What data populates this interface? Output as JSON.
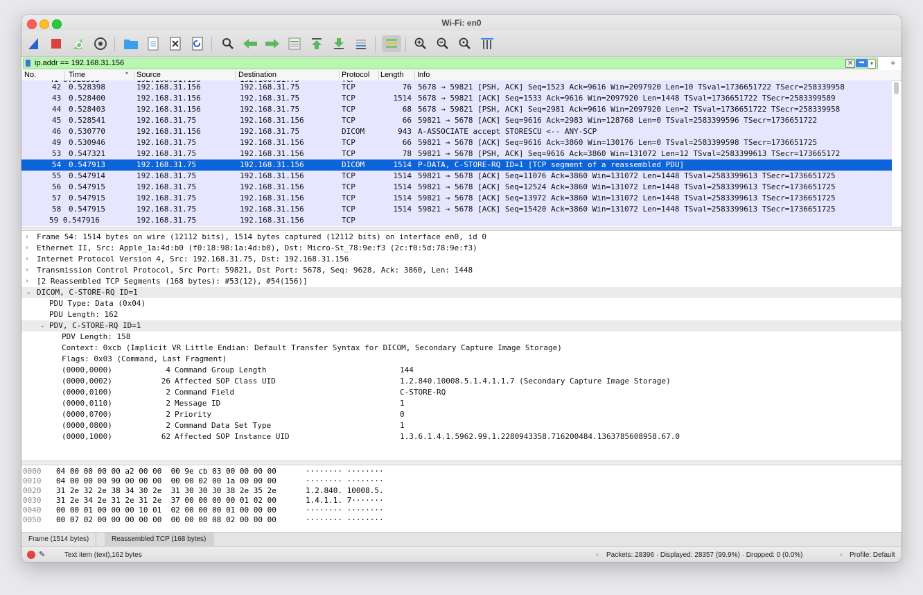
{
  "window": {
    "title": "Wi-Fi: en0"
  },
  "filter": {
    "text": "ip.addr == 192.168.31.156",
    "plus": "+"
  },
  "columns": {
    "no": "No.",
    "time": "Time",
    "source": "Source",
    "destination": "Destination",
    "protocol": "Protocol",
    "length": "Length",
    "info": "Info"
  },
  "packets": [
    {
      "no": "42",
      "time": "0.528398",
      "src": "192.168.31.156",
      "dst": "192.168.31.75",
      "proto": "TCP",
      "len": "76",
      "info": "5678 → 59821 [PSH, ACK] Seq=1523 Ack=9616 Win=2097920 Len=10 TSval=1736651722 TSecr=258339958"
    },
    {
      "no": "43",
      "time": "0.528400",
      "src": "192.168.31.156",
      "dst": "192.168.31.75",
      "proto": "TCP",
      "len": "1514",
      "info": "5678 → 59821 [ACK] Seq=1533 Ack=9616 Win=2097920 Len=1448 TSval=1736651722 TSecr=2583399589"
    },
    {
      "no": "44",
      "time": "0.528403",
      "src": "192.168.31.156",
      "dst": "192.168.31.75",
      "proto": "TCP",
      "len": "68",
      "info": "5678 → 59821 [PSH, ACK] Seq=2981 Ack=9616 Win=2097920 Len=2 TSval=1736651722 TSecr=258339958"
    },
    {
      "no": "45",
      "time": "0.528541",
      "src": "192.168.31.75",
      "dst": "192.168.31.156",
      "proto": "TCP",
      "len": "66",
      "info": "59821 → 5678 [ACK] Seq=9616 Ack=2983 Win=128768 Len=0 TSval=2583399596 TSecr=1736651722"
    },
    {
      "no": "46",
      "time": "0.530770",
      "src": "192.168.31.156",
      "dst": "192.168.31.75",
      "proto": "DICOM",
      "len": "943",
      "info": "A-ASSOCIATE accept  STORESCU <-- ANY-SCP"
    },
    {
      "no": "49",
      "time": "0.530946",
      "src": "192.168.31.75",
      "dst": "192.168.31.156",
      "proto": "TCP",
      "len": "66",
      "info": "59821 → 5678 [ACK] Seq=9616 Ack=3860 Win=130176 Len=0 TSval=2583399598 TSecr=1736651725"
    },
    {
      "no": "53",
      "time": "0.547321",
      "src": "192.168.31.75",
      "dst": "192.168.31.156",
      "proto": "TCP",
      "len": "78",
      "info": "59821 → 5678 [PSH, ACK] Seq=9616 Ack=3860 Win=131072 Len=12 TSval=2583399613 TSecr=173665172"
    },
    {
      "no": "54",
      "time": "0.547913",
      "src": "192.168.31.75",
      "dst": "192.168.31.156",
      "proto": "DICOM",
      "len": "1514",
      "info": "P-DATA, C-STORE-RQ ID=1 [TCP segment of a reassembled PDU]"
    },
    {
      "no": "55",
      "time": "0.547914",
      "src": "192.168.31.75",
      "dst": "192.168.31.156",
      "proto": "TCP",
      "len": "1514",
      "info": "59821 → 5678 [ACK] Seq=11076 Ack=3860 Win=131072 Len=1448 TSval=2583399613 TSecr=1736651725"
    },
    {
      "no": "56",
      "time": "0.547915",
      "src": "192.168.31.75",
      "dst": "192.168.31.156",
      "proto": "TCP",
      "len": "1514",
      "info": "59821 → 5678 [ACK] Seq=12524 Ack=3860 Win=131072 Len=1448 TSval=2583399613 TSecr=1736651725"
    },
    {
      "no": "57",
      "time": "0.547915",
      "src": "192.168.31.75",
      "dst": "192.168.31.156",
      "proto": "TCP",
      "len": "1514",
      "info": "59821 → 5678 [ACK] Seq=13972 Ack=3860 Win=131072 Len=1448 TSval=2583399613 TSecr=1736651725"
    },
    {
      "no": "58",
      "time": "0.547915",
      "src": "192.168.31.75",
      "dst": "192.168.31.156",
      "proto": "TCP",
      "len": "1514",
      "info": "59821 → 5678 [ACK] Seq=15420 Ack=3860 Win=131072 Len=1448 TSval=2583399613 TSecr=1736651725"
    }
  ],
  "selected_packet": "54",
  "details": [
    {
      "text": "Frame 54: 1514 bytes on wire (12112 bits), 1514 bytes captured (12112 bits) on interface en0, id 0"
    },
    {
      "text": "Ethernet II, Src: Apple_1a:4d:b0 (f0:18:98:1a:4d:b0), Dst: Micro-St_78:9e:f3 (2c:f0:5d:78:9e:f3)"
    },
    {
      "text": "Internet Protocol Version 4, Src: 192.168.31.75, Dst: 192.168.31.156"
    },
    {
      "text": "Transmission Control Protocol, Src Port: 59821, Dst Port: 5678, Seq: 9628, Ack: 3860, Len: 1448"
    },
    {
      "text": "[2 Reassembled TCP Segments (168 bytes): #53(12), #54(156)]"
    },
    {
      "text": "DICOM, C-STORE-RQ ID=1"
    },
    {
      "text": "PDU Type: Data (0x04)"
    },
    {
      "text": "PDU Length: 162"
    },
    {
      "text": "PDV, C-STORE-RQ ID=1"
    },
    {
      "text": "PDV Length: 158"
    },
    {
      "text": "Context: 0xcb (Implicit VR Little Endian: Default Transfer Syntax for DICOM, Secondary Capture Image Storage)"
    },
    {
      "text": "Flags: 0x03 (Command, Last Fragment)"
    }
  ],
  "dicom_elements": [
    {
      "tag": "(0000,0000)",
      "len": "4",
      "name": "Command Group Length",
      "value": "144"
    },
    {
      "tag": "(0000,0002)",
      "len": "26",
      "name": "Affected SOP Class UID",
      "value": "1.2.840.10008.5.1.4.1.1.7 (Secondary Capture Image Storage)"
    },
    {
      "tag": "(0000,0100)",
      "len": "2",
      "name": "Command Field",
      "value": "C-STORE-RQ"
    },
    {
      "tag": "(0000,0110)",
      "len": "2",
      "name": "Message ID",
      "value": "1"
    },
    {
      "tag": "(0000,0700)",
      "len": "2",
      "name": "Priority",
      "value": "0"
    },
    {
      "tag": "(0000,0800)",
      "len": "2",
      "name": "Command Data Set Type",
      "value": "1"
    },
    {
      "tag": "(0000,1000)",
      "len": "62",
      "name": "Affected SOP Instance UID",
      "value": "1.3.6.1.4.1.5962.99.1.2280943358.716200484.1363785608958.67.0"
    }
  ],
  "hex": [
    {
      "off": "0000",
      "hex": "04 00 00 00 00 a2 00 00  00 9e cb 03 00 00 00 00",
      "ascii": "········ ········"
    },
    {
      "off": "0010",
      "hex": "04 00 00 00 90 00 00 00  00 00 02 00 1a 00 00 00",
      "ascii": "········ ········"
    },
    {
      "off": "0020",
      "hex": "31 2e 32 2e 38 34 30 2e  31 30 30 30 38 2e 35 2e",
      "ascii": "1.2.840. 10008.5."
    },
    {
      "off": "0030",
      "hex": "31 2e 34 2e 31 2e 31 2e  37 00 00 00 00 01 02 00",
      "ascii": "1.4.1.1. 7·······"
    },
    {
      "off": "0040",
      "hex": "00 00 01 00 00 00 10 01  02 00 00 00 01 00 00 00",
      "ascii": "········ ········"
    },
    {
      "off": "0050",
      "hex": "00 07 02 00 00 00 00 00  00 00 00 08 02 00 00 00",
      "ascii": "········ ········"
    }
  ],
  "byte_tabs": [
    "Frame (1514 bytes)",
    "Reassembled TCP (168 bytes)"
  ],
  "status": {
    "left": "Text item (text),162 bytes",
    "packets": "Packets: 28396 · Displayed: 28357 (99.9%) · Dropped: 0 (0.0%)",
    "profile": "Profile: Default"
  },
  "toolbar_icons": [
    "shark-fin-start-icon",
    "stop-icon",
    "restart-icon",
    "capture-options-icon",
    "open-folder-icon",
    "save-file-icon",
    "close-file-icon",
    "reload-icon",
    "find-icon",
    "go-back-icon",
    "go-forward-icon",
    "go-to-packet-icon",
    "go-first-icon",
    "go-last-icon",
    "auto-scroll-icon",
    "colorize-icon",
    "zoom-in-icon",
    "zoom-out-icon",
    "zoom-reset-icon",
    "resize-columns-icon"
  ],
  "colors": {
    "row_bg": "#e7e6ff",
    "selected_row": "#0d63da",
    "filter_bg": "#b8f7b0"
  }
}
